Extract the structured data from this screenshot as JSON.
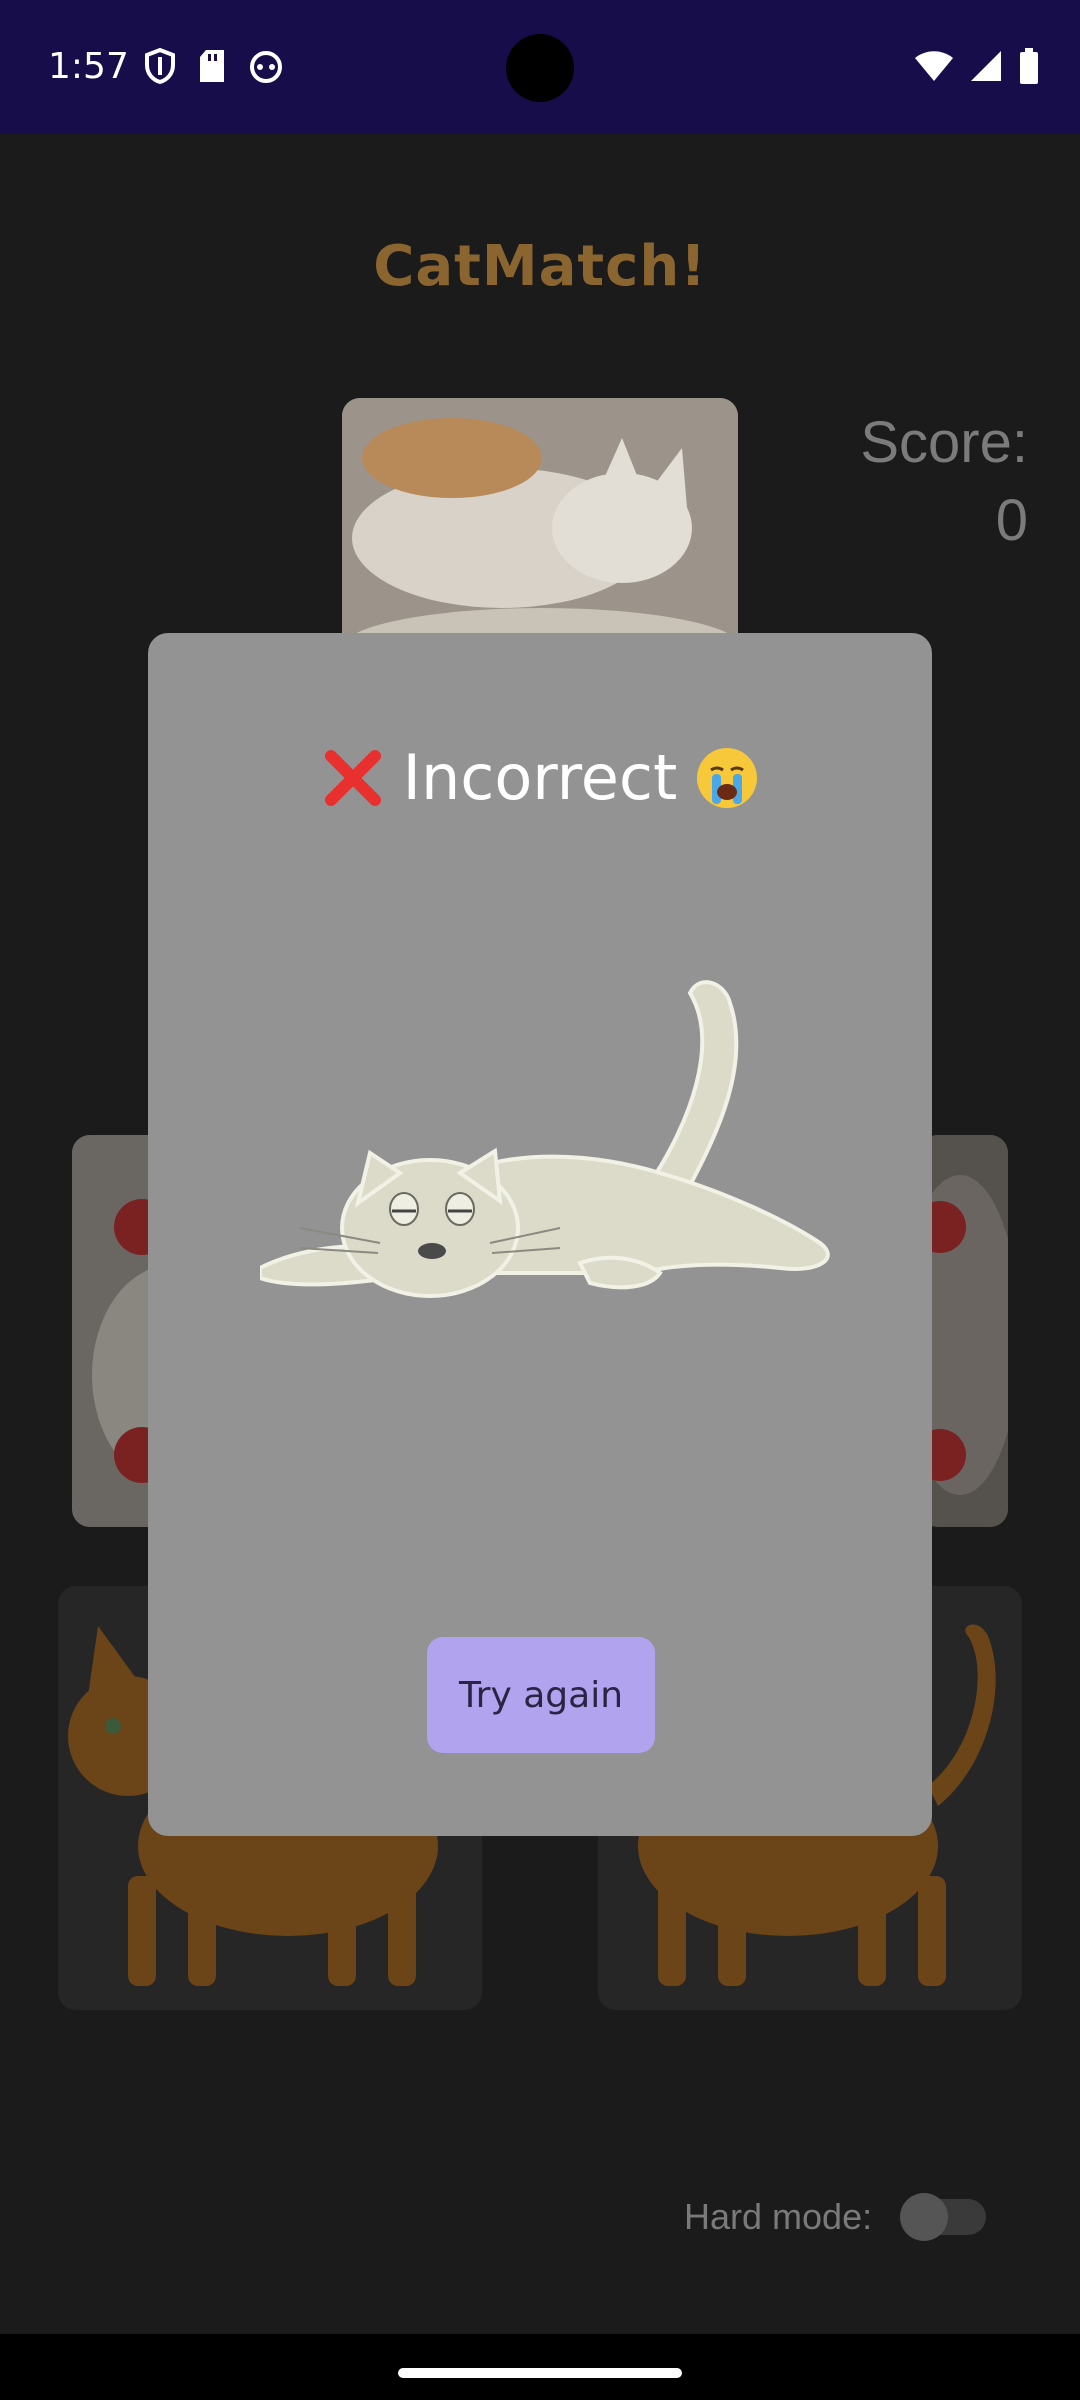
{
  "status": {
    "time": "1:57"
  },
  "app": {
    "title": "CatMatch!",
    "score_label": "Score:",
    "score_value": "0",
    "hard_mode_label": "Hard mode:",
    "hard_mode_on": false
  },
  "dialog": {
    "title": "Incorrect",
    "button": "Try again"
  }
}
